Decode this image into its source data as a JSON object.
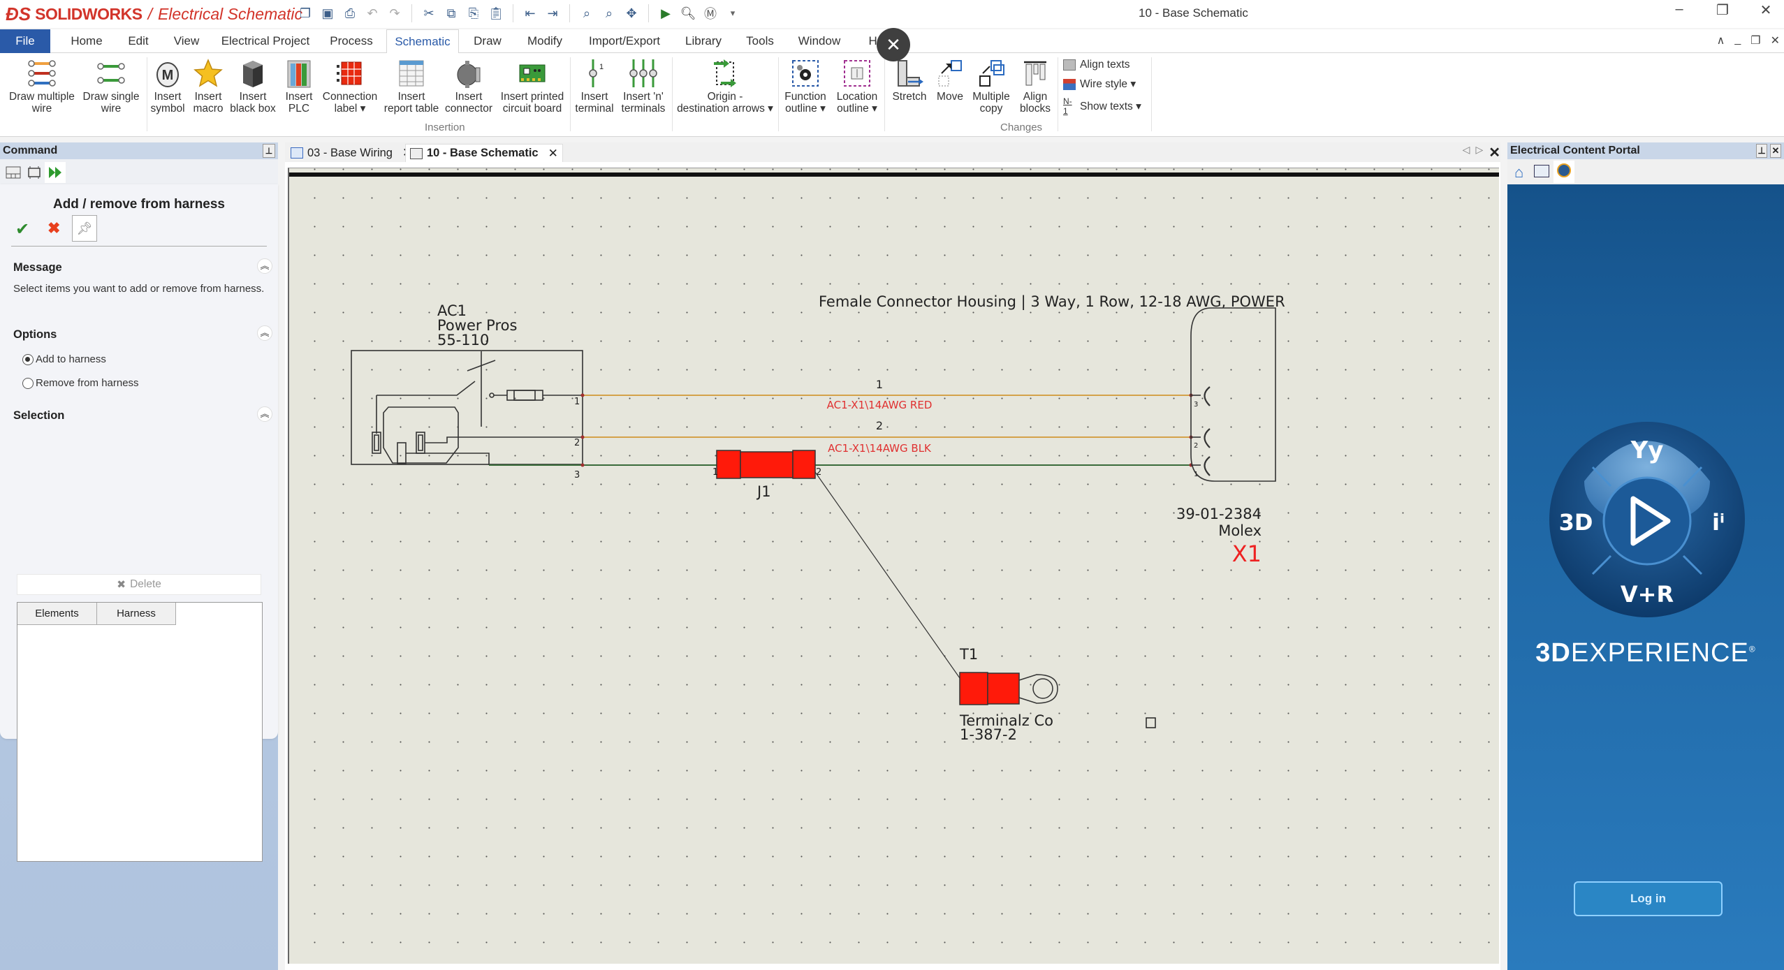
{
  "app": {
    "brand": "SOLIDWORKS",
    "product": "Electrical Schematic",
    "document_title": "10 - Base Schematic",
    "window_controls": [
      "minimize",
      "restore",
      "close"
    ]
  },
  "quick_access": [
    "new-document-icon",
    "save-icon",
    "print-icon",
    "undo-icon",
    "redo-icon",
    "cut-icon",
    "copy-icon",
    "paste-special-icon",
    "paste-icon",
    "copy-page-icon",
    "paste-page-icon",
    "zoom-window-icon",
    "zoom-area-icon",
    "pan-icon",
    "run-macro-icon",
    "find-icon",
    "macro-icon",
    "customize-dropdown-icon"
  ],
  "menu": {
    "tabs": [
      "File",
      "Home",
      "Edit",
      "View",
      "Electrical Project",
      "Process",
      "Schematic",
      "Draw",
      "Modify",
      "Import/Export",
      "Library",
      "Tools",
      "Window",
      "Help"
    ],
    "active": "Schematic"
  },
  "ribbon": {
    "buttons": [
      {
        "label": "Draw multiple\nwire",
        "icon": "multiple-wire-icon"
      },
      {
        "label": "Draw single\nwire",
        "icon": "single-wire-icon"
      },
      {
        "label": "Insert\nsymbol",
        "icon": "motor-symbol-icon"
      },
      {
        "label": "Insert\nmacro",
        "icon": "star-macro-icon"
      },
      {
        "label": "Insert\nblack box",
        "icon": "black-box-icon"
      },
      {
        "label": "Insert\nPLC",
        "icon": "plc-icon"
      },
      {
        "label": "Connection\nlabel ▾",
        "icon": "connection-label-icon"
      },
      {
        "label": "Insert\nreport table",
        "icon": "report-table-icon"
      },
      {
        "label": "Insert\nconnector",
        "icon": "connector-icon"
      },
      {
        "label": "Insert printed\ncircuit board",
        "icon": "pcb-icon"
      },
      {
        "label": "Insert\nterminal",
        "icon": "terminal-icon"
      },
      {
        "label": "Insert 'n'\nterminals",
        "icon": "n-terminals-icon"
      },
      {
        "label": "Origin -\ndestination arrows ▾",
        "icon": "origin-destination-icon"
      },
      {
        "label": "Function\noutline ▾",
        "icon": "function-outline-icon"
      },
      {
        "label": "Location\noutline ▾",
        "icon": "location-outline-icon"
      },
      {
        "label": "Stretch",
        "icon": "stretch-icon"
      },
      {
        "label": "Move",
        "icon": "move-icon"
      },
      {
        "label": "Multiple\ncopy",
        "icon": "multiple-copy-icon"
      },
      {
        "label": "Align\nblocks",
        "icon": "align-blocks-icon"
      }
    ],
    "small_buttons": [
      {
        "label": "Align texts",
        "icon": "align-texts-icon"
      },
      {
        "label": "Wire style ▾",
        "icon": "wire-style-icon"
      },
      {
        "label": "Show texts ▾",
        "icon": "show-texts-icon"
      }
    ],
    "groups": [
      "Insertion",
      "Changes"
    ]
  },
  "command_panel": {
    "header": "Command",
    "title": "Add / remove from harness",
    "sections": {
      "message": {
        "title": "Message",
        "text": "Select items you want to add or remove from harness."
      },
      "options": {
        "title": "Options",
        "radios": [
          {
            "label": "Add to harness",
            "checked": true
          },
          {
            "label": "Remove from harness",
            "checked": false
          }
        ]
      },
      "selection": {
        "title": "Selection",
        "delete_label": "Delete",
        "columns": [
          "Elements",
          "Harness"
        ],
        "rows": []
      }
    }
  },
  "doc_tabs": [
    {
      "label": "03 - Base Wiring",
      "active": false
    },
    {
      "label": "10 - Base Schematic",
      "active": true
    }
  ],
  "schematic": {
    "ac1": {
      "tag": "AC1",
      "manufacturer": "Power Pros",
      "part": "55-110",
      "pins": [
        "1",
        "2",
        "3"
      ]
    },
    "x1": {
      "description": "Female Connector Housing | 3 Way, 1 Row, 12-18 AWG, POWER",
      "part": "39-01-2384",
      "manufacturer": "Molex",
      "tag": "X1",
      "pins": [
        "3",
        "2",
        "1"
      ]
    },
    "wires": [
      {
        "number": "1",
        "label": "AC1-X1\\14AWG RED",
        "color": "#d4a24a"
      },
      {
        "number": "2",
        "label": "AC1-X1\\14AWG BLK",
        "color": "#d4a24a"
      },
      {
        "number": "",
        "label": "",
        "color": "#3a6b3a"
      }
    ],
    "j1": {
      "tag": "J1",
      "pins": [
        "1",
        "2"
      ]
    },
    "t1": {
      "tag": "T1",
      "manufacturer": "Terminalz Co",
      "part": "1-387-2"
    },
    "colors": {
      "component_fill": "#ff1a0a",
      "label_red": "#e03030",
      "tag_red": "#ee2222"
    }
  },
  "content_portal": {
    "header": "Electrical Content Portal",
    "tabs": [
      "home-icon",
      "catalog-icon",
      "portal-icon"
    ],
    "logo_labels": {
      "top": "Yy",
      "left": "3D",
      "right": "iⁱ",
      "bottom": "V+R"
    },
    "brand_bold": "3D",
    "brand_rest": "EXPERIENCE",
    "registered": "®",
    "login_label": "Log in"
  }
}
